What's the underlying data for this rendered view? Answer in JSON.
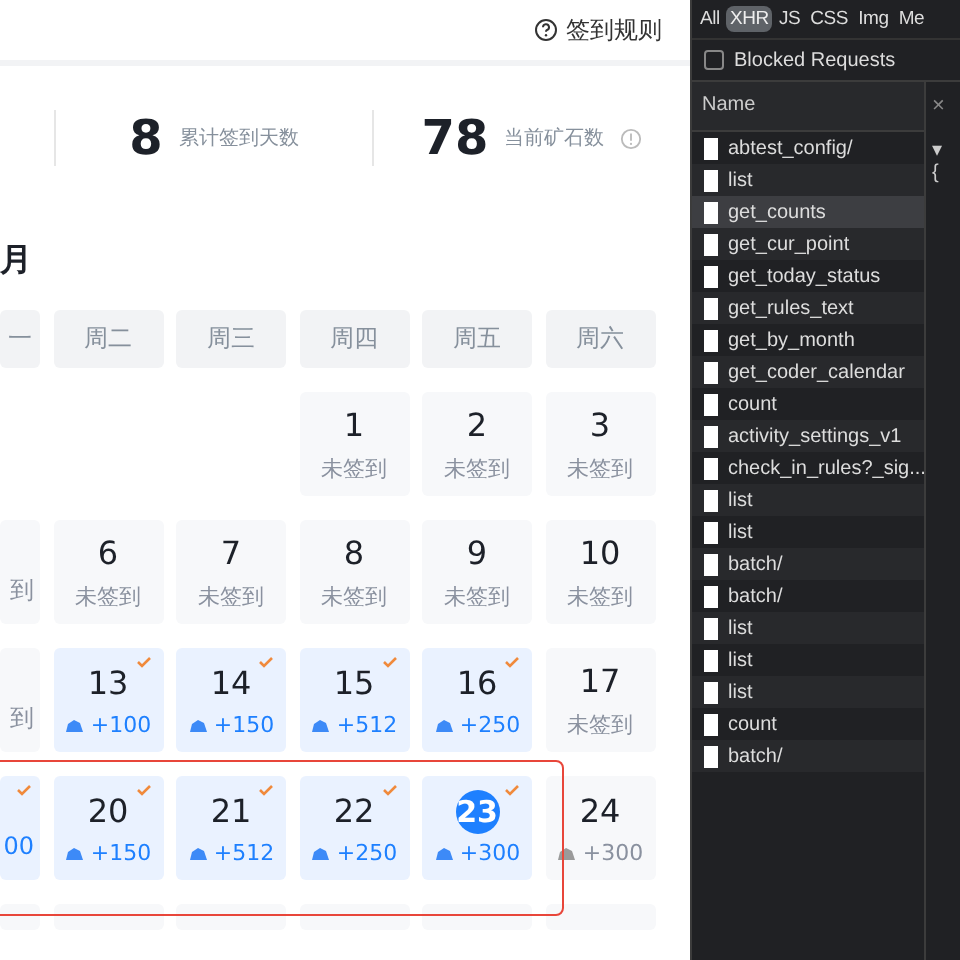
{
  "header": {
    "rules_link": "签到规则"
  },
  "stats": [
    {
      "kind": "days",
      "value": "8",
      "label": "累计签到天数"
    },
    {
      "kind": "ore",
      "value": "78",
      "label": "当前矿石数"
    }
  ],
  "month_heading": "月",
  "weekdays": [
    {
      "label": "一"
    },
    {
      "label": "周二"
    },
    {
      "label": "周三"
    },
    {
      "label": "周四"
    },
    {
      "label": "周五"
    },
    {
      "label": "周六"
    }
  ],
  "weeks": [
    [
      {
        "kind": "blank"
      },
      {
        "kind": "blank"
      },
      {
        "kind": "blank"
      },
      {
        "kind": "unsigned",
        "day": "1",
        "label": "未签到"
      },
      {
        "kind": "unsigned",
        "day": "2",
        "label": "未签到"
      },
      {
        "kind": "unsigned",
        "day": "3",
        "label": "未签到"
      }
    ],
    [
      {
        "kind": "clipped",
        "label": "到",
        "signed": false
      },
      {
        "kind": "unsigned",
        "day": "6",
        "label": "未签到"
      },
      {
        "kind": "unsigned",
        "day": "7",
        "label": "未签到"
      },
      {
        "kind": "unsigned",
        "day": "8",
        "label": "未签到"
      },
      {
        "kind": "unsigned",
        "day": "9",
        "label": "未签到"
      },
      {
        "kind": "unsigned",
        "day": "10",
        "label": "未签到"
      }
    ],
    [
      {
        "kind": "clipped",
        "label": "到",
        "signed": false
      },
      {
        "kind": "signed",
        "day": "13",
        "label": "+100",
        "today": false
      },
      {
        "kind": "signed",
        "day": "14",
        "label": "+150",
        "today": false
      },
      {
        "kind": "signed",
        "day": "15",
        "label": "+512",
        "today": false
      },
      {
        "kind": "signed",
        "day": "16",
        "label": "+250",
        "today": false
      },
      {
        "kind": "unsigned",
        "day": "17",
        "label": "未签到"
      }
    ],
    [
      {
        "kind": "clipped",
        "label": "00",
        "signed": true
      },
      {
        "kind": "signed",
        "day": "20",
        "label": "+150",
        "today": false
      },
      {
        "kind": "signed",
        "day": "21",
        "label": "+512",
        "today": false
      },
      {
        "kind": "signed",
        "day": "22",
        "label": "+250",
        "today": false
      },
      {
        "kind": "signed",
        "day": "23",
        "label": "+300",
        "today": true
      },
      {
        "kind": "upcoming",
        "day": "24",
        "label": "+300"
      }
    ],
    [
      {
        "kind": "cut"
      },
      {
        "kind": "cut"
      },
      {
        "kind": "cut"
      },
      {
        "kind": "cut"
      },
      {
        "kind": "cut"
      },
      {
        "kind": "cut"
      }
    ]
  ],
  "devtools": {
    "filters": [
      {
        "label": "All",
        "selected": false
      },
      {
        "label": "XHR",
        "selected": true
      },
      {
        "label": "JS",
        "selected": false
      },
      {
        "label": "CSS",
        "selected": false
      },
      {
        "label": "Img",
        "selected": false
      },
      {
        "label": "Me",
        "selected": false
      }
    ],
    "blocked_requests": {
      "label": "Blocked Requests",
      "checked": false
    },
    "name_header": "Name",
    "close": "×",
    "preview": "▾ {",
    "requests": [
      {
        "name": "abtest_config/",
        "selected": false
      },
      {
        "name": "list",
        "selected": false
      },
      {
        "name": "get_counts",
        "selected": true
      },
      {
        "name": "get_cur_point",
        "selected": false
      },
      {
        "name": "get_today_status",
        "selected": false
      },
      {
        "name": "get_rules_text",
        "selected": false
      },
      {
        "name": "get_by_month",
        "selected": false
      },
      {
        "name": "get_coder_calendar",
        "selected": false
      },
      {
        "name": "count",
        "selected": false
      },
      {
        "name": "activity_settings_v1",
        "selected": false
      },
      {
        "name": "check_in_rules?_sig...",
        "selected": false
      },
      {
        "name": "list",
        "selected": false
      },
      {
        "name": "list",
        "selected": false
      },
      {
        "name": "batch/",
        "selected": false
      },
      {
        "name": "batch/",
        "selected": false
      },
      {
        "name": "list",
        "selected": false
      },
      {
        "name": "list",
        "selected": false
      },
      {
        "name": "list",
        "selected": false
      },
      {
        "name": "count",
        "selected": false
      },
      {
        "name": "batch/",
        "selected": false
      }
    ]
  }
}
